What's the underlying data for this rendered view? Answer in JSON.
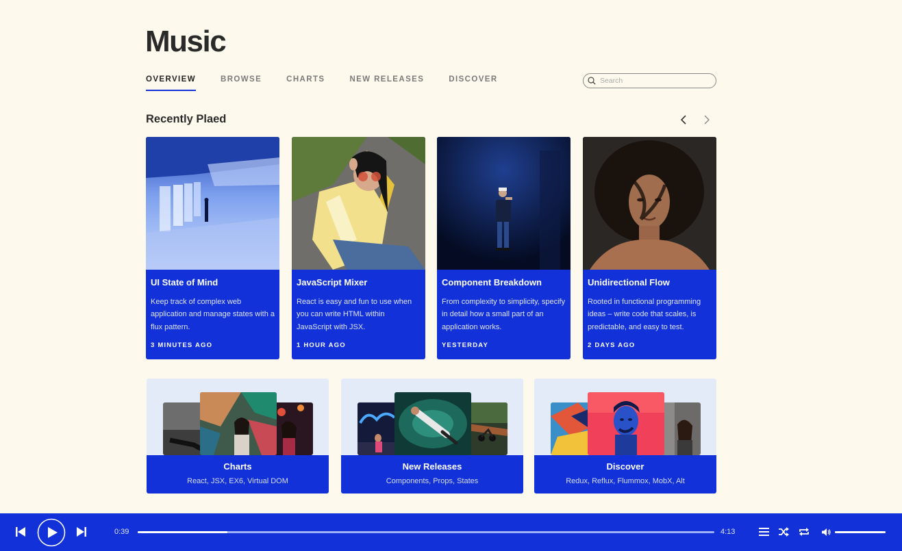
{
  "app": {
    "title": "Music"
  },
  "nav": {
    "tabs": [
      {
        "label": "OVERVIEW",
        "active": true
      },
      {
        "label": "BROWSE",
        "active": false
      },
      {
        "label": "CHARTS",
        "active": false
      },
      {
        "label": "NEW RELEASES",
        "active": false
      },
      {
        "label": "DISCOVER",
        "active": false
      }
    ]
  },
  "search": {
    "placeholder": "Search",
    "value": ""
  },
  "recent": {
    "title": "Recently Plaed",
    "prev_icon": "chevron-left-icon",
    "next_icon": "chevron-right-icon",
    "cards": [
      {
        "title": "UI State of Mind",
        "desc": "Keep track of complex web application and manage states with a flux pattern.",
        "time": "3 MINUTES AGO"
      },
      {
        "title": "JavaScript Mixer",
        "desc": "React is easy and fun to use when you can write HTML within JavaScript with JSX.",
        "time": "1 HOUR AGO"
      },
      {
        "title": "Component Breakdown",
        "desc": "From complexity to simplicity, specify in detail how a small part of an application works.",
        "time": "YESTERDAY"
      },
      {
        "title": "Unidirectional Flow",
        "desc": "Rooted in functional programming ideas – write code that scales, is predictable, and easy to test.",
        "time": "2 DAYS AGO"
      }
    ]
  },
  "categories": [
    {
      "title": "Charts",
      "subtitle": "React, JSX, EX6, Virtual DOM"
    },
    {
      "title": "New Releases",
      "subtitle": "Components, Props, States"
    },
    {
      "title": "Discover",
      "subtitle": "Redux, Reflux, Flummox, MobX, Alt"
    }
  ],
  "player": {
    "current_time": "0:39",
    "total_time": "4:13",
    "progress_fraction": 0.155,
    "volume_fraction": 1.0,
    "icons": [
      "skip-back-icon",
      "play-icon",
      "skip-forward-icon",
      "queue-icon",
      "shuffle-icon",
      "repeat-icon",
      "volume-icon"
    ]
  },
  "colors": {
    "background": "#fdf9ec",
    "accent": "#1231d8",
    "text": "#2a2a2a"
  }
}
